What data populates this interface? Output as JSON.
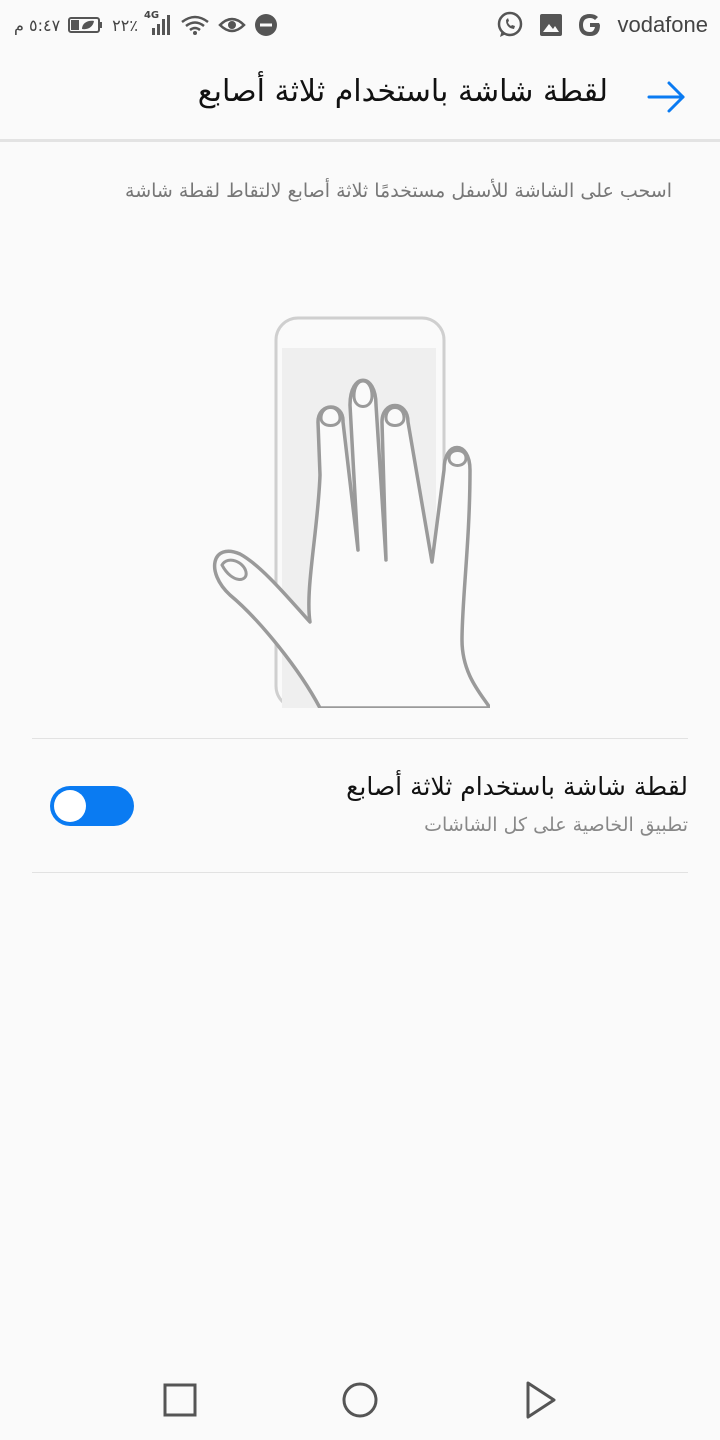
{
  "status_bar": {
    "time": "٥:٤٧ م",
    "battery_percent": "٢٢٪",
    "network_type": "4G",
    "carrier": "vodafone",
    "icons": [
      "leaf-battery-icon",
      "signal-icon",
      "wifi-icon",
      "eye-icon",
      "do-not-disturb-icon",
      "whatsapp-icon",
      "image-icon",
      "google-icon"
    ]
  },
  "header": {
    "title": "لقطة شاشة باستخدام ثلاثة أصابع",
    "back_icon": "arrow-right-icon"
  },
  "description": "اسحب على الشاشة للأسفل مستخدمًا ثلاثة أصابع لالتقاط لقطة شاشة",
  "setting": {
    "title": "لقطة شاشة باستخدام ثلاثة أصابع",
    "subtitle": "تطبيق الخاصية على كل الشاشات",
    "enabled": true
  },
  "nav_bar": {
    "icons": [
      "recent-apps-icon",
      "home-icon",
      "back-icon"
    ]
  },
  "colors": {
    "accent": "#0a7bf2",
    "background": "#fafafa"
  }
}
